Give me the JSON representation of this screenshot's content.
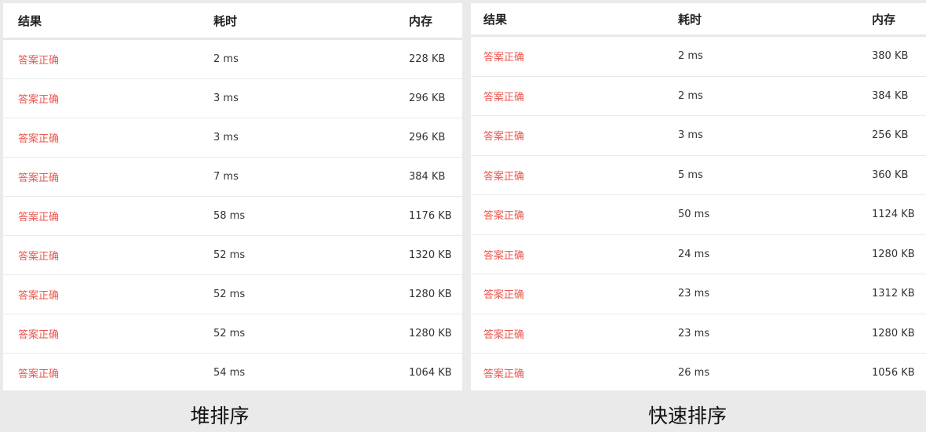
{
  "columns": {
    "result": "结果",
    "time": "耗时",
    "memory": "内存"
  },
  "colors": {
    "result_text": "#e8584f",
    "background": "#eaeaea",
    "panel": "#ffffff"
  },
  "left": {
    "caption": "堆排序",
    "rows": [
      {
        "result": "答案正确",
        "time": "2 ms",
        "memory": "228 KB"
      },
      {
        "result": "答案正确",
        "time": "3 ms",
        "memory": "296 KB"
      },
      {
        "result": "答案正确",
        "time": "3 ms",
        "memory": "296 KB"
      },
      {
        "result": "答案正确",
        "time": "7 ms",
        "memory": "384 KB"
      },
      {
        "result": "答案正确",
        "time": "58 ms",
        "memory": "1176 KB"
      },
      {
        "result": "答案正确",
        "time": "52 ms",
        "memory": "1320 KB"
      },
      {
        "result": "答案正确",
        "time": "52 ms",
        "memory": "1280 KB"
      },
      {
        "result": "答案正确",
        "time": "52 ms",
        "memory": "1280 KB"
      },
      {
        "result": "答案正确",
        "time": "54 ms",
        "memory": "1064 KB"
      }
    ]
  },
  "right": {
    "caption": "快速排序",
    "rows": [
      {
        "result": "答案正确",
        "time": "2 ms",
        "memory": "380 KB"
      },
      {
        "result": "答案正确",
        "time": "2 ms",
        "memory": "384 KB"
      },
      {
        "result": "答案正确",
        "time": "3 ms",
        "memory": "256 KB"
      },
      {
        "result": "答案正确",
        "time": "5 ms",
        "memory": "360 KB"
      },
      {
        "result": "答案正确",
        "time": "50 ms",
        "memory": "1124 KB"
      },
      {
        "result": "答案正确",
        "time": "24 ms",
        "memory": "1280 KB"
      },
      {
        "result": "答案正确",
        "time": "23 ms",
        "memory": "1312 KB"
      },
      {
        "result": "答案正确",
        "time": "23 ms",
        "memory": "1280 KB"
      },
      {
        "result": "答案正确",
        "time": "26 ms",
        "memory": "1056 KB"
      }
    ]
  }
}
